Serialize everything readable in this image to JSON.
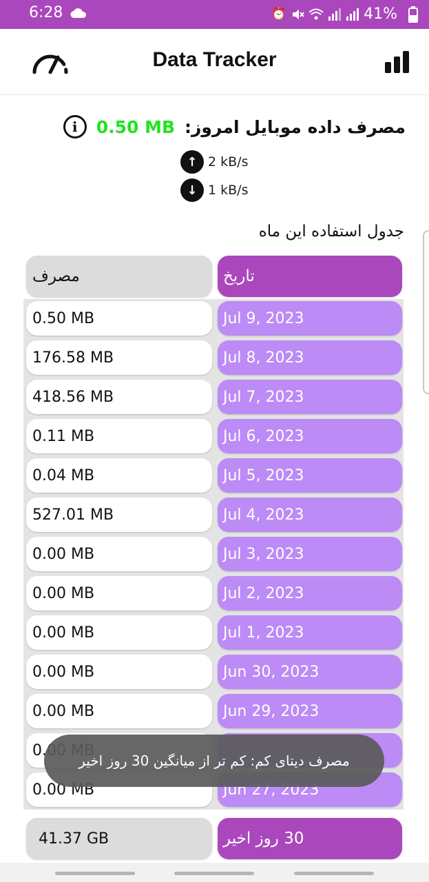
{
  "status_bar": {
    "time": "6:28",
    "battery": "41%",
    "background": "#ab47bc",
    "icons": [
      "cloud-icon",
      "alarm-icon",
      "mute-icon",
      "wifi-icon",
      "signal-icon",
      "battery-icon"
    ]
  },
  "app_bar": {
    "title": "Data Tracker",
    "left_icon": "speedometer-icon",
    "right_icon": "bar-chart-icon"
  },
  "today": {
    "label": "مصرف داده موبایل امروز:",
    "value": "0.50 MB",
    "value_color": "#22e322",
    "info_icon": "i"
  },
  "speed": {
    "upload": "2 kB/s",
    "download": "1 kB/s"
  },
  "table": {
    "title": "جدول استفاده این ماه",
    "headers": {
      "date": "تاریخ",
      "usage": "مصرف"
    },
    "rows": [
      {
        "date": "Jul 9, 2023",
        "usage": "0.50 MB"
      },
      {
        "date": "Jul 8, 2023",
        "usage": "176.58 MB"
      },
      {
        "date": "Jul 7, 2023",
        "usage": "418.56 MB"
      },
      {
        "date": "Jul 6, 2023",
        "usage": "0.11 MB"
      },
      {
        "date": "Jul 5, 2023",
        "usage": "0.04 MB"
      },
      {
        "date": "Jul 4, 2023",
        "usage": "527.01 MB"
      },
      {
        "date": "Jul 3, 2023",
        "usage": "0.00 MB"
      },
      {
        "date": "Jul 2, 2023",
        "usage": "0.00 MB"
      },
      {
        "date": "Jul 1, 2023",
        "usage": "0.00 MB"
      },
      {
        "date": "Jun 30, 2023",
        "usage": "0.00 MB"
      },
      {
        "date": "Jun 29, 2023",
        "usage": "0.00 MB"
      },
      {
        "date": "",
        "usage": "0.00 MB"
      },
      {
        "date": "Jun 27, 2023",
        "usage": "0.00 MB"
      }
    ],
    "total": {
      "label": "30 روز اخیر",
      "usage": "41.37 GB"
    }
  },
  "toast": {
    "message": "مصرف دیتای کم: کم تر از میانگین 30 روز اخیر"
  },
  "colors": {
    "accent": "#ab47bc",
    "date_cell": "#bc8bf5",
    "usage_header": "#dcdcdc"
  }
}
